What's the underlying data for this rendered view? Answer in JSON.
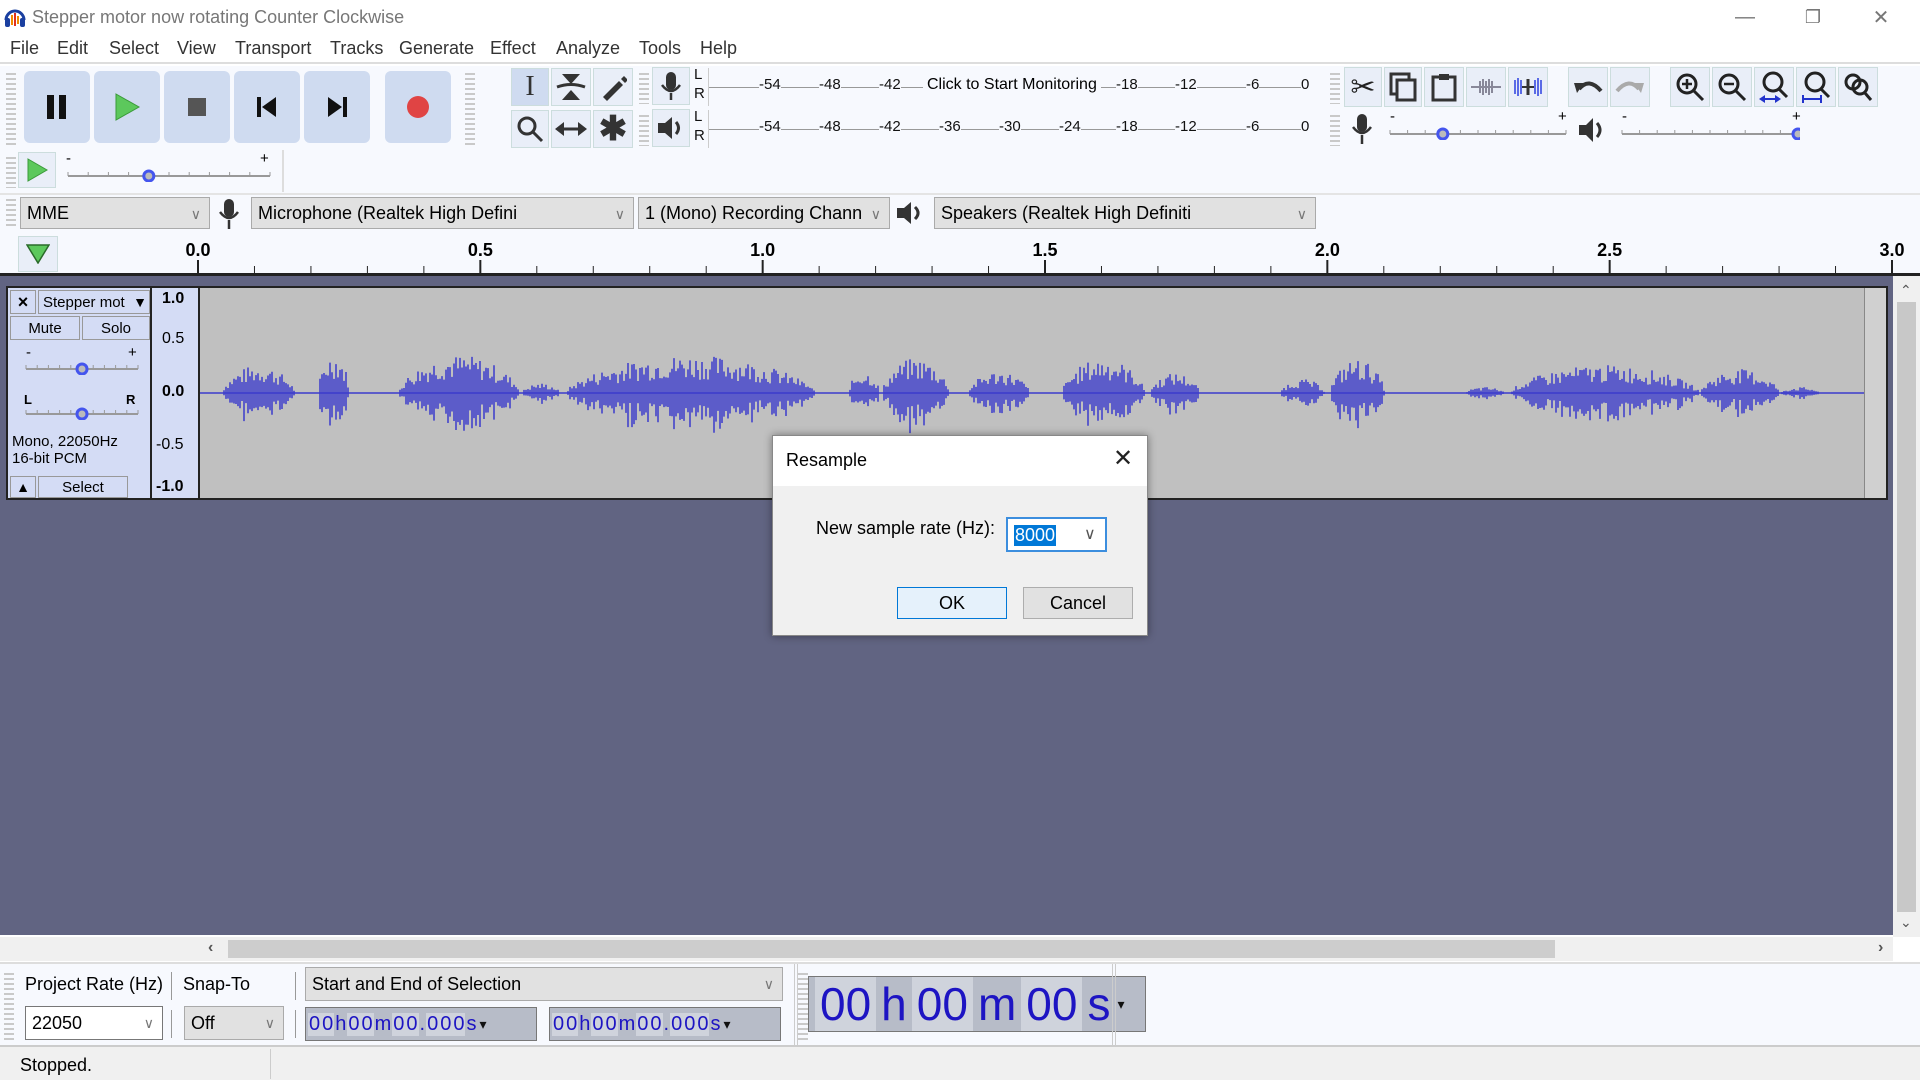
{
  "window": {
    "title": "Stepper motor now rotating Counter Clockwise",
    "controls": [
      "minimize",
      "restore",
      "close"
    ]
  },
  "menu": [
    "File",
    "Edit",
    "Select",
    "View",
    "Transport",
    "Tracks",
    "Generate",
    "Effect",
    "Analyze",
    "Tools",
    "Help"
  ],
  "transport": {
    "buttons": [
      "pause",
      "play",
      "stop",
      "skip-to-start",
      "skip-to-end",
      "record"
    ]
  },
  "tools": [
    "selection-tool",
    "envelope-tool",
    "draw-tool",
    "zoom-tool",
    "time-shift-tool",
    "multi-tool"
  ],
  "meters": {
    "record": {
      "channels": [
        "L",
        "R"
      ],
      "ticks": [
        "-54",
        "-48",
        "-42",
        "-18",
        "-12",
        "-6",
        "0"
      ],
      "prompt": "Click to Start Monitoring"
    },
    "playback": {
      "channels": [
        "L",
        "R"
      ],
      "ticks": [
        "-54",
        "-48",
        "-42",
        "-36",
        "-30",
        "-24",
        "-18",
        "-12",
        "-6",
        "0"
      ]
    }
  },
  "edit_tools": [
    "cut",
    "copy",
    "paste",
    "trim-audio",
    "silence-audio",
    "undo",
    "redo",
    "zoom-in",
    "zoom-out",
    "fit-selection",
    "fit-project",
    "zoom-toggle"
  ],
  "mixer": {
    "record_volume": 0.3,
    "playback_volume": 1.0,
    "minus": "-",
    "plus": "+"
  },
  "play_at_speed": {
    "speed": 0.4,
    "minus": "-",
    "plus": "+"
  },
  "devices": {
    "host": "MME",
    "recording_device": "Microphone (Realtek High Defini",
    "channels": "1 (Mono) Recording Chann",
    "playback_device": "Speakers (Realtek High Definiti"
  },
  "timeline": {
    "labels": [
      "0.0",
      "0.5",
      "1.0",
      "1.5",
      "2.0",
      "2.5",
      "3.0"
    ]
  },
  "track": {
    "name": "Stepper mot",
    "close": "×",
    "mute": "Mute",
    "solo": "Solo",
    "gain_minus": "-",
    "gain_plus": "+",
    "pan_left": "L",
    "pan_right": "R",
    "gain": 0.5,
    "pan": 0.5,
    "info1": "Mono, 22050Hz",
    "info2": "16-bit PCM",
    "select": "Select",
    "scale": [
      "1.0",
      "0.5",
      "0.0",
      "-0.5",
      "-1.0"
    ]
  },
  "dialog": {
    "title": "Resample",
    "label": "New sample rate (Hz):",
    "value": "8000",
    "ok": "OK",
    "cancel": "Cancel"
  },
  "selection_toolbar": {
    "project_rate_label": "Project Rate (Hz)",
    "project_rate": "22050",
    "snap_label": "Snap-To",
    "snap": "Off",
    "selection_mode": "Start and End of Selection",
    "start_time": [
      "0",
      "0",
      "h",
      "0",
      "0",
      "m",
      "0",
      "0",
      ".",
      "0",
      "0",
      "0",
      "s"
    ],
    "end_time": [
      "0",
      "0",
      "h",
      "0",
      "0",
      "m",
      "0",
      "0",
      ".",
      "0",
      "0",
      "0",
      "s"
    ]
  },
  "time_display": [
    "00",
    "h",
    "00",
    "m",
    "00",
    "s"
  ],
  "status": "Stopped.",
  "colors": {
    "waveform": "#3b3bcc",
    "track_bg": "#c0c0c0",
    "area_bg": "#616482",
    "time_text": "#1d14c3",
    "record": "#e04444",
    "play": "#5cc85c"
  }
}
